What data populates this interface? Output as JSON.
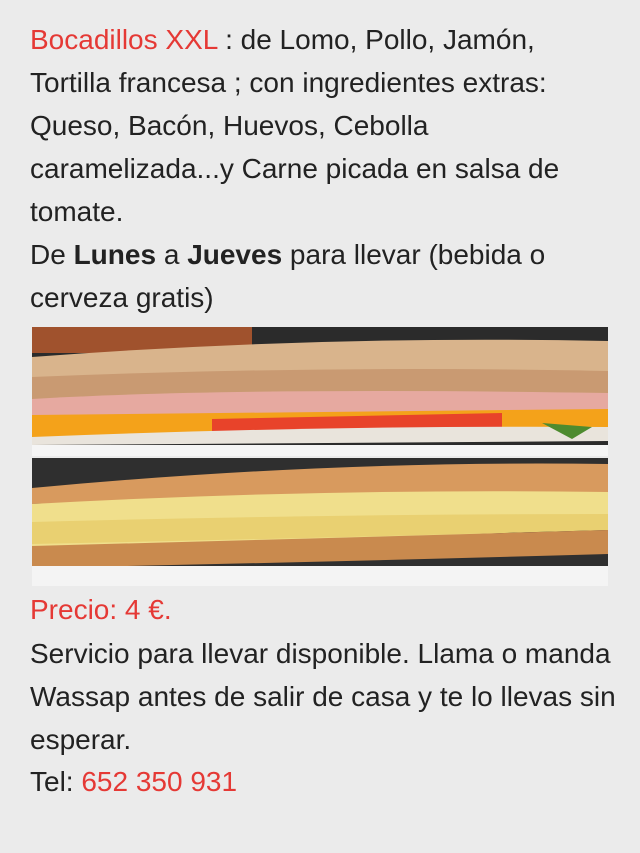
{
  "intro": {
    "title": "Bocadillos XXL",
    "text": " : de Lomo, Pollo, Jamón, Tortilla francesa ; con ingredientes extras: Queso, Bacón, Huevos, Cebolla caramelizada...y Carne picada en salsa de tomate."
  },
  "days": {
    "prefix": "De ",
    "from": "Lunes",
    "middle": " a ",
    "to": "Jueves",
    "suffix": " para llevar (bebida o cerveza gratis)"
  },
  "price": {
    "label": "Precio: 4 €."
  },
  "service": {
    "text": "Servicio para llevar disponible. Llama o manda Wassap antes de salir de casa y te lo llevas sin esperar."
  },
  "contact": {
    "label": "Tel: ",
    "phone": "652 350 931"
  },
  "colors": {
    "accent": "#e53935",
    "text": "#222222",
    "background": "#ebebeb"
  }
}
